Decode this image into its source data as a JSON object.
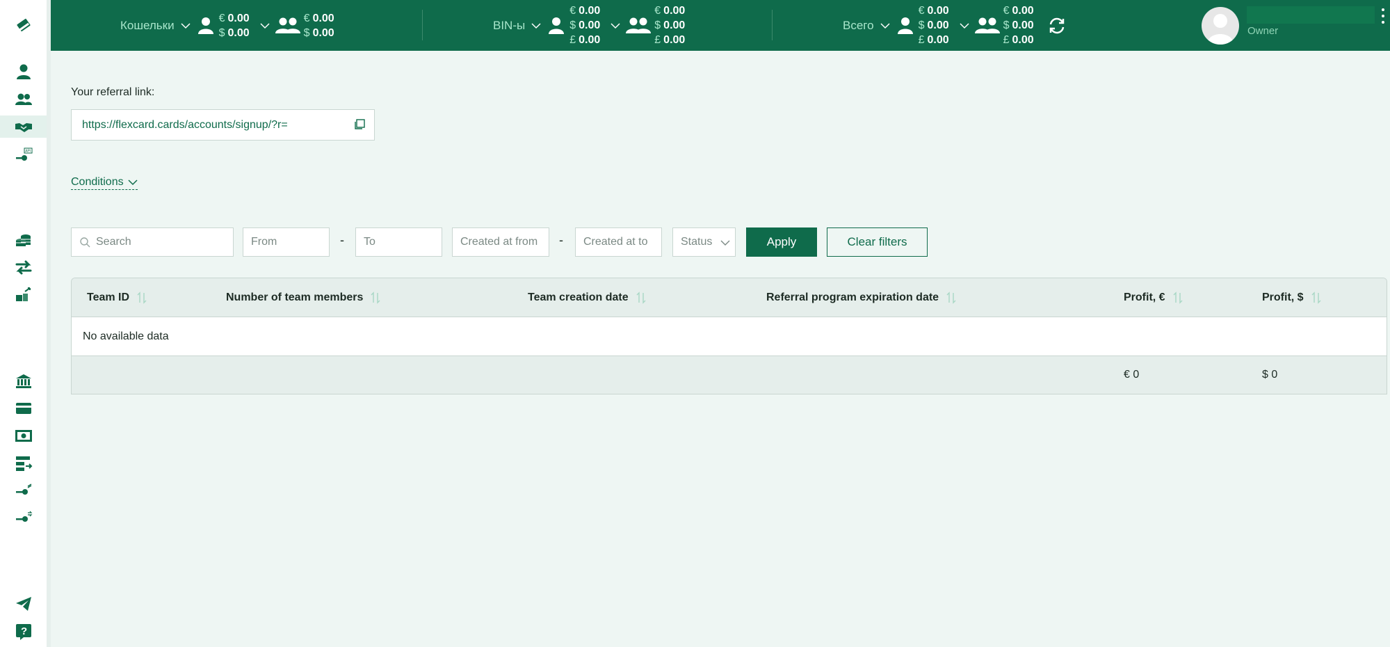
{
  "topbar": {
    "wallets": {
      "label": "Кошельки",
      "personal": [
        {
          "cur": "€",
          "val": "0.00"
        },
        {
          "cur": "$",
          "val": "0.00"
        }
      ],
      "team": [
        {
          "cur": "€",
          "val": "0.00"
        },
        {
          "cur": "$",
          "val": "0.00"
        }
      ]
    },
    "bins": {
      "label": "BIN-ы",
      "personal": [
        {
          "cur": "€",
          "val": "0.00"
        },
        {
          "cur": "$",
          "val": "0.00"
        },
        {
          "cur": "£",
          "val": "0.00"
        }
      ],
      "team": [
        {
          "cur": "€",
          "val": "0.00"
        },
        {
          "cur": "$",
          "val": "0.00"
        },
        {
          "cur": "£",
          "val": "0.00"
        }
      ]
    },
    "total": {
      "label": "Всего",
      "personal": [
        {
          "cur": "€",
          "val": "0.00"
        },
        {
          "cur": "$",
          "val": "0.00"
        },
        {
          "cur": "£",
          "val": "0.00"
        }
      ],
      "team": [
        {
          "cur": "€",
          "val": "0.00"
        },
        {
          "cur": "$",
          "val": "0.00"
        },
        {
          "cur": "£",
          "val": "0.00"
        }
      ]
    },
    "user": {
      "role": "Owner"
    }
  },
  "sidebar": {
    "items": [
      "logo-icon",
      "user-icon",
      "team-icon",
      "handshake-icon",
      "api-key-icon",
      "coins-icon",
      "transfer-icon",
      "cash-exchange-icon",
      "bank-icon",
      "card-icon",
      "banknote-icon",
      "statement-icon",
      "key-icon",
      "key-alt-icon",
      "telegram-icon",
      "help-icon"
    ]
  },
  "referral": {
    "label": "Your referral link:",
    "link": "https://flexcard.cards/accounts/signup/?r="
  },
  "conditions": {
    "label": "Conditions"
  },
  "filters": {
    "search_placeholder": "Search",
    "from_placeholder": "From",
    "to_placeholder": "To",
    "created_from_placeholder": "Created at from",
    "created_to_placeholder": "Created at to",
    "status_placeholder": "Status",
    "dash": "-",
    "apply_label": "Apply",
    "clear_label": "Clear filters"
  },
  "table": {
    "columns": [
      "Team ID",
      "Number of team members",
      "Team creation date",
      "Referral program expiration date",
      "Profit, €",
      "Profit, $"
    ],
    "empty_text": "No available data",
    "footer": {
      "profit_eur": "€ 0",
      "profit_usd": "$ 0"
    }
  },
  "colors": {
    "brand": "#0f6b4b",
    "accent_light": "#a8e6cb",
    "background": "#eef6f3"
  }
}
